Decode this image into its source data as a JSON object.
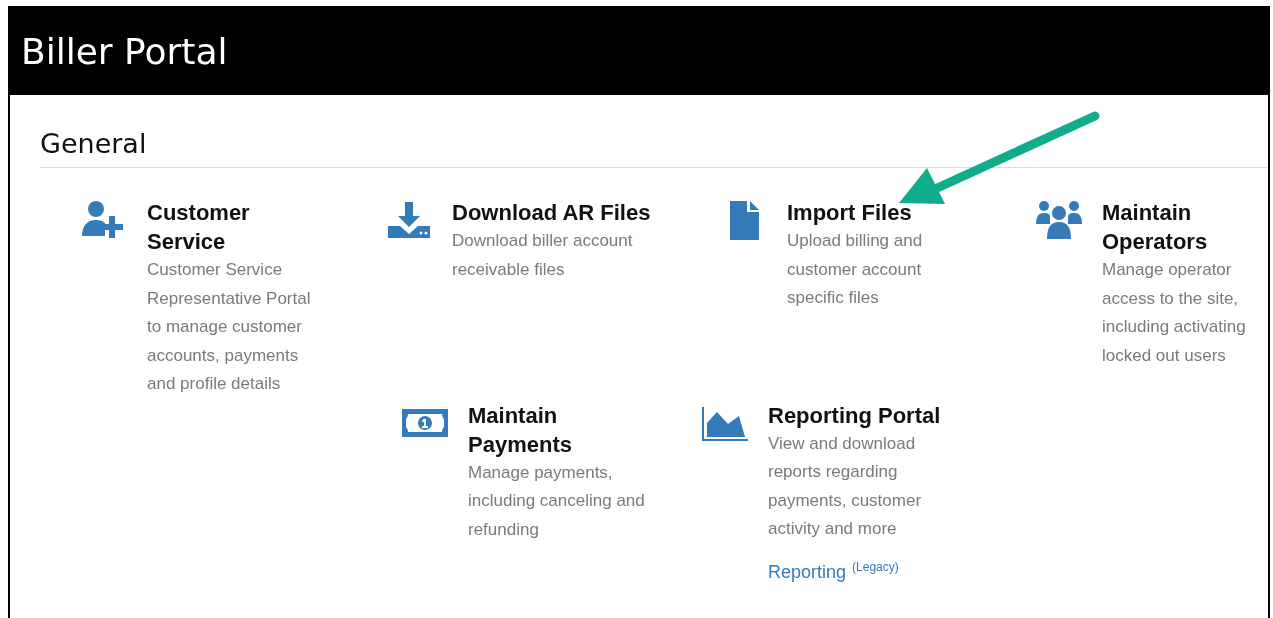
{
  "header": {
    "title": "Biller Portal"
  },
  "section": {
    "title": "General"
  },
  "rows": [
    {
      "tiles": [
        {
          "kind": "person-add",
          "title": "Customer Service",
          "description": "Customer Service Representative Portal to manage customer accounts, payments and profile details"
        },
        {
          "kind": "download",
          "title": "Download AR Files",
          "description": "Download biller account receivable files"
        },
        {
          "kind": "file",
          "title": "Import Files",
          "description": "Upload billing and customer account specific files"
        },
        {
          "kind": "users",
          "title": "Maintain Operators",
          "description": "Manage operator access to the site, including activating locked out users"
        }
      ]
    },
    {
      "tiles": [
        {
          "kind": "money",
          "title": "Maintain Payments",
          "description": "Manage payments, including canceling and refunding"
        },
        {
          "kind": "chart",
          "title": "Reporting Portal",
          "description": "View and download reports regarding payments, customer activity and more",
          "link": {
            "label": "Reporting",
            "note": "(Legacy)"
          }
        }
      ]
    }
  ]
}
